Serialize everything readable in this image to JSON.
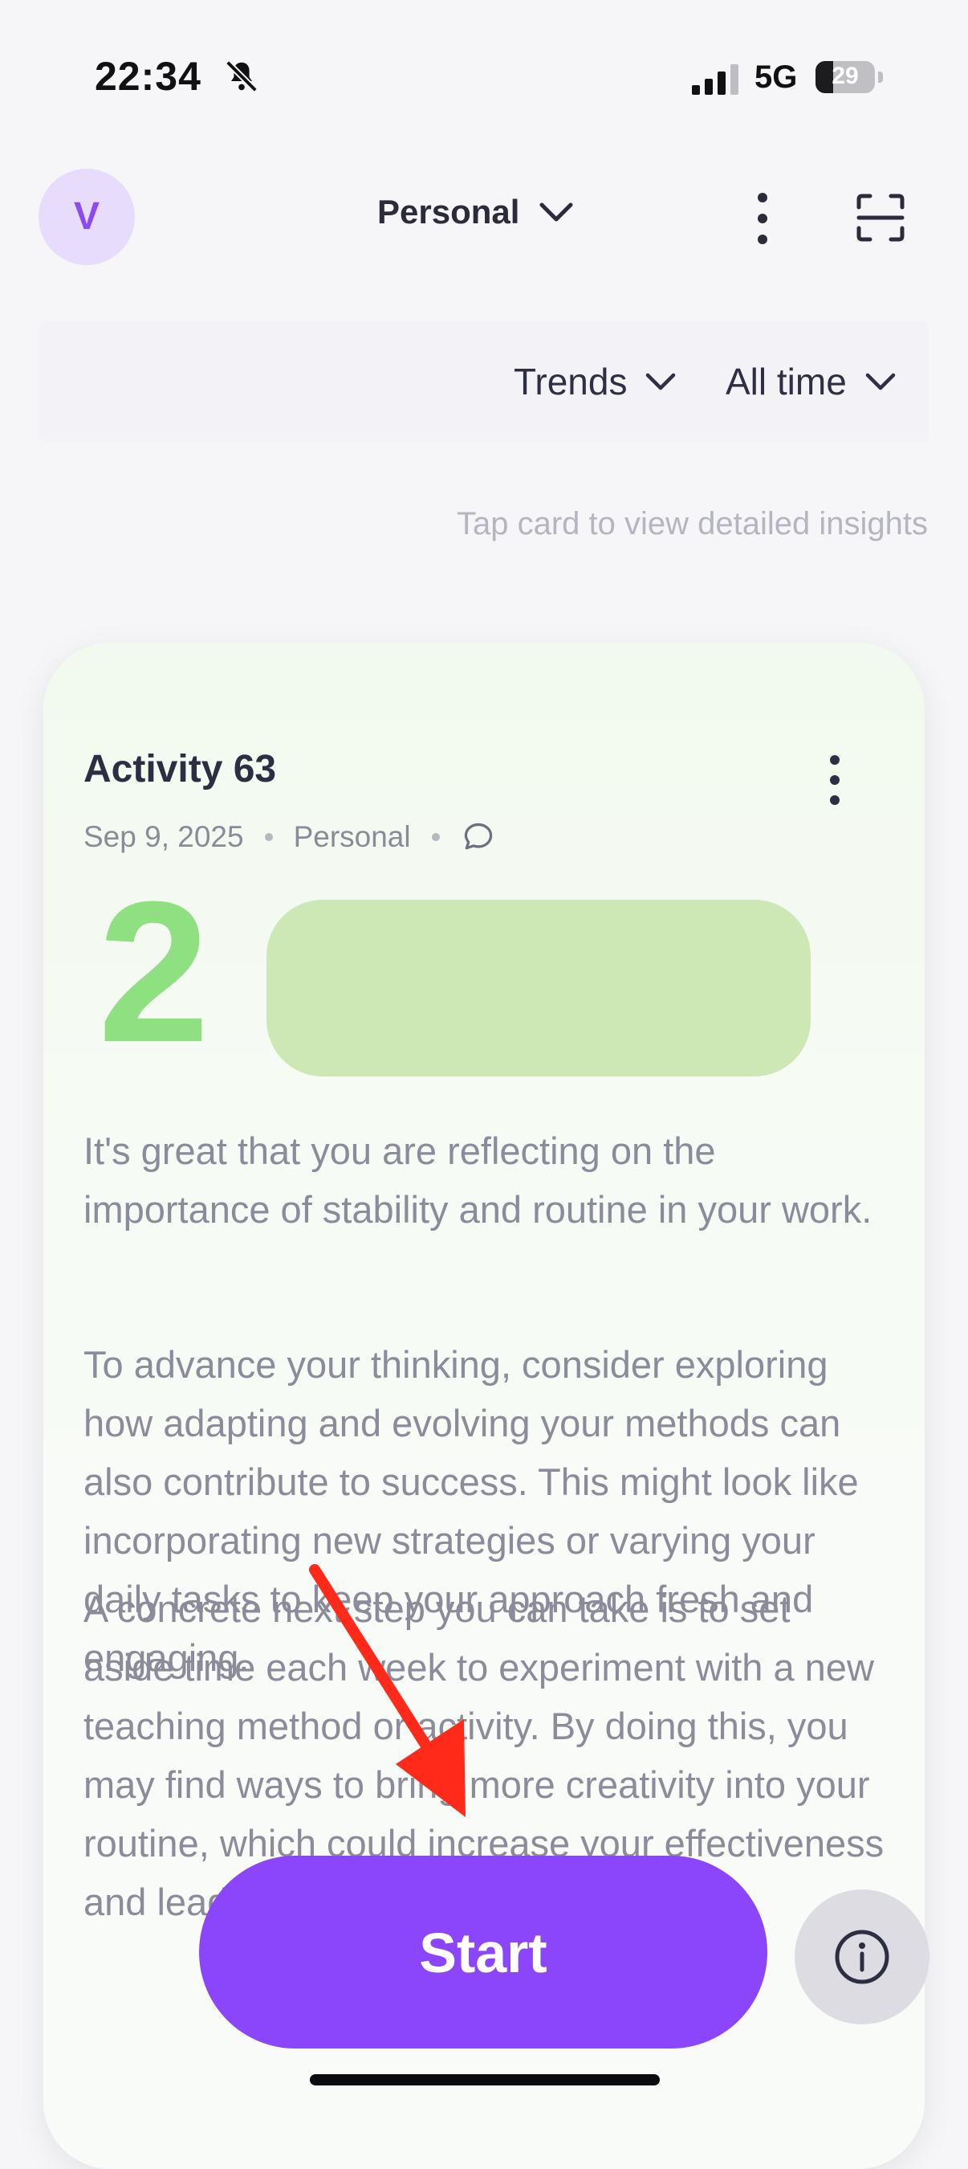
{
  "status_bar": {
    "time": "22:34",
    "network": "5G",
    "battery": "29"
  },
  "header": {
    "avatar_initial": "V",
    "workspace": "Personal"
  },
  "filters": {
    "view": "Trends",
    "range": "All time"
  },
  "hint": "Tap card to view detailed insights",
  "card": {
    "title": "Activity 63",
    "date": "Sep 9, 2025",
    "category": "Personal",
    "score": "2",
    "paragraphs": [
      "It's great that you are reflecting on the importance of stability and routine in your work.",
      "To advance your thinking, consider exploring how adapting and evolving your methods can also contribute to success. This might look like incorporating new strategies or varying your daily tasks to keep your approach fresh and engaging.",
      "A concrete next step you can take is to set aside time each week to experiment with a new teaching method or activity. By doing this, you may find ways to bring more creativity into your routine, which could increase your effectiveness and lead to greater professional growth."
    ]
  },
  "actions": {
    "start_label": "Start"
  },
  "colors": {
    "accent": "#8b46fb",
    "score": "#8ee081",
    "card_bg": "#f2faef",
    "annotation": "#ff2a1a"
  },
  "icons": [
    "bell-slash-icon",
    "signal-icon",
    "battery-icon",
    "chevron-down-icon",
    "more-vertical-icon",
    "scan-icon",
    "comment-icon",
    "info-icon"
  ]
}
